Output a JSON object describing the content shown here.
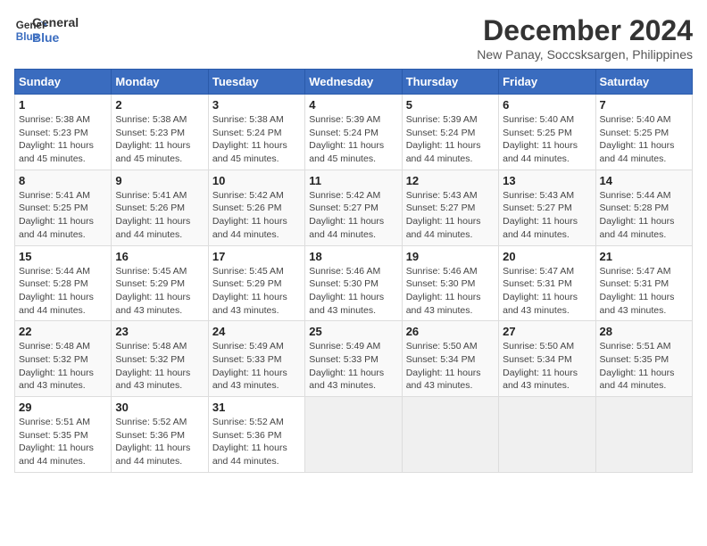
{
  "header": {
    "logo_line1": "General",
    "logo_line2": "Blue",
    "title": "December 2024",
    "subtitle": "New Panay, Soccsksargen, Philippines"
  },
  "weekdays": [
    "Sunday",
    "Monday",
    "Tuesday",
    "Wednesday",
    "Thursday",
    "Friday",
    "Saturday"
  ],
  "weeks": [
    [
      {
        "day": "1",
        "info": "Sunrise: 5:38 AM\nSunset: 5:23 PM\nDaylight: 11 hours\nand 45 minutes."
      },
      {
        "day": "2",
        "info": "Sunrise: 5:38 AM\nSunset: 5:23 PM\nDaylight: 11 hours\nand 45 minutes."
      },
      {
        "day": "3",
        "info": "Sunrise: 5:38 AM\nSunset: 5:24 PM\nDaylight: 11 hours\nand 45 minutes."
      },
      {
        "day": "4",
        "info": "Sunrise: 5:39 AM\nSunset: 5:24 PM\nDaylight: 11 hours\nand 45 minutes."
      },
      {
        "day": "5",
        "info": "Sunrise: 5:39 AM\nSunset: 5:24 PM\nDaylight: 11 hours\nand 44 minutes."
      },
      {
        "day": "6",
        "info": "Sunrise: 5:40 AM\nSunset: 5:25 PM\nDaylight: 11 hours\nand 44 minutes."
      },
      {
        "day": "7",
        "info": "Sunrise: 5:40 AM\nSunset: 5:25 PM\nDaylight: 11 hours\nand 44 minutes."
      }
    ],
    [
      {
        "day": "8",
        "info": "Sunrise: 5:41 AM\nSunset: 5:25 PM\nDaylight: 11 hours\nand 44 minutes."
      },
      {
        "day": "9",
        "info": "Sunrise: 5:41 AM\nSunset: 5:26 PM\nDaylight: 11 hours\nand 44 minutes."
      },
      {
        "day": "10",
        "info": "Sunrise: 5:42 AM\nSunset: 5:26 PM\nDaylight: 11 hours\nand 44 minutes."
      },
      {
        "day": "11",
        "info": "Sunrise: 5:42 AM\nSunset: 5:27 PM\nDaylight: 11 hours\nand 44 minutes."
      },
      {
        "day": "12",
        "info": "Sunrise: 5:43 AM\nSunset: 5:27 PM\nDaylight: 11 hours\nand 44 minutes."
      },
      {
        "day": "13",
        "info": "Sunrise: 5:43 AM\nSunset: 5:27 PM\nDaylight: 11 hours\nand 44 minutes."
      },
      {
        "day": "14",
        "info": "Sunrise: 5:44 AM\nSunset: 5:28 PM\nDaylight: 11 hours\nand 44 minutes."
      }
    ],
    [
      {
        "day": "15",
        "info": "Sunrise: 5:44 AM\nSunset: 5:28 PM\nDaylight: 11 hours\nand 44 minutes."
      },
      {
        "day": "16",
        "info": "Sunrise: 5:45 AM\nSunset: 5:29 PM\nDaylight: 11 hours\nand 43 minutes."
      },
      {
        "day": "17",
        "info": "Sunrise: 5:45 AM\nSunset: 5:29 PM\nDaylight: 11 hours\nand 43 minutes."
      },
      {
        "day": "18",
        "info": "Sunrise: 5:46 AM\nSunset: 5:30 PM\nDaylight: 11 hours\nand 43 minutes."
      },
      {
        "day": "19",
        "info": "Sunrise: 5:46 AM\nSunset: 5:30 PM\nDaylight: 11 hours\nand 43 minutes."
      },
      {
        "day": "20",
        "info": "Sunrise: 5:47 AM\nSunset: 5:31 PM\nDaylight: 11 hours\nand 43 minutes."
      },
      {
        "day": "21",
        "info": "Sunrise: 5:47 AM\nSunset: 5:31 PM\nDaylight: 11 hours\nand 43 minutes."
      }
    ],
    [
      {
        "day": "22",
        "info": "Sunrise: 5:48 AM\nSunset: 5:32 PM\nDaylight: 11 hours\nand 43 minutes."
      },
      {
        "day": "23",
        "info": "Sunrise: 5:48 AM\nSunset: 5:32 PM\nDaylight: 11 hours\nand 43 minutes."
      },
      {
        "day": "24",
        "info": "Sunrise: 5:49 AM\nSunset: 5:33 PM\nDaylight: 11 hours\nand 43 minutes."
      },
      {
        "day": "25",
        "info": "Sunrise: 5:49 AM\nSunset: 5:33 PM\nDaylight: 11 hours\nand 43 minutes."
      },
      {
        "day": "26",
        "info": "Sunrise: 5:50 AM\nSunset: 5:34 PM\nDaylight: 11 hours\nand 43 minutes."
      },
      {
        "day": "27",
        "info": "Sunrise: 5:50 AM\nSunset: 5:34 PM\nDaylight: 11 hours\nand 43 minutes."
      },
      {
        "day": "28",
        "info": "Sunrise: 5:51 AM\nSunset: 5:35 PM\nDaylight: 11 hours\nand 44 minutes."
      }
    ],
    [
      {
        "day": "29",
        "info": "Sunrise: 5:51 AM\nSunset: 5:35 PM\nDaylight: 11 hours\nand 44 minutes."
      },
      {
        "day": "30",
        "info": "Sunrise: 5:52 AM\nSunset: 5:36 PM\nDaylight: 11 hours\nand 44 minutes."
      },
      {
        "day": "31",
        "info": "Sunrise: 5:52 AM\nSunset: 5:36 PM\nDaylight: 11 hours\nand 44 minutes."
      },
      null,
      null,
      null,
      null
    ]
  ]
}
